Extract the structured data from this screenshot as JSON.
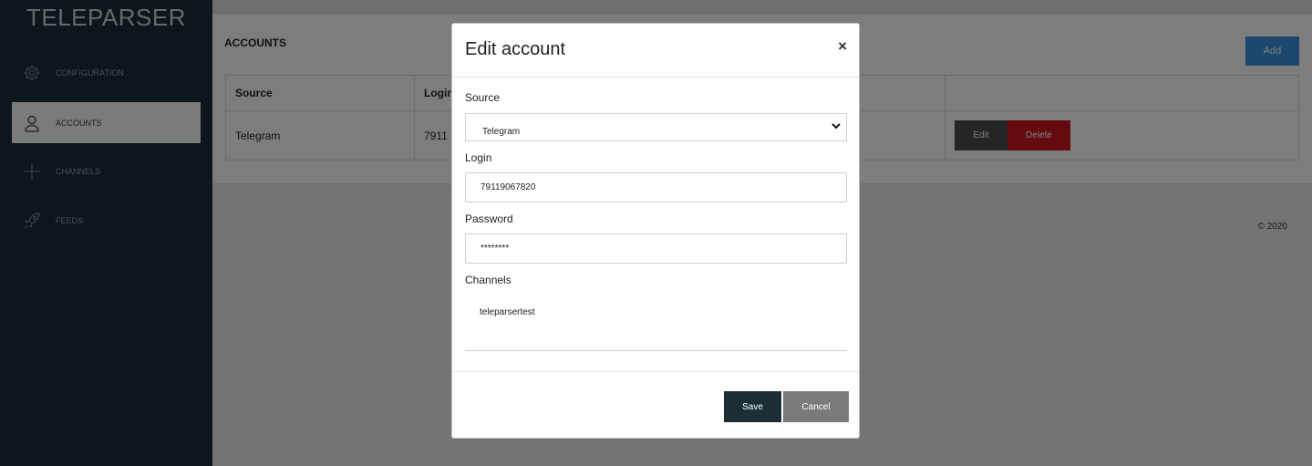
{
  "app": {
    "brand": "TELEPARSER"
  },
  "sidebar": {
    "items": [
      {
        "label": "CONFIGURATION",
        "icon": "gear-icon",
        "active": false
      },
      {
        "label": "ACCOUNTS",
        "icon": "user-icon",
        "active": true
      },
      {
        "label": "CHANNELS",
        "icon": "plus-icon",
        "active": false
      },
      {
        "label": "FEEDS",
        "icon": "rocket-icon",
        "active": false
      }
    ]
  },
  "accounts": {
    "title": "ACCOUNTS",
    "add_label": "Add",
    "columns": [
      "Source",
      "Login",
      "",
      ""
    ],
    "rows": [
      {
        "source": "Telegram",
        "login": "7911",
        "edit_label": "Edit",
        "delete_label": "Delete"
      }
    ]
  },
  "footer": {
    "copyright": "© 2020"
  },
  "modal": {
    "title": "Edit account",
    "close": "×",
    "source_label": "Source",
    "source_value": "Telegram",
    "login_label": "Login",
    "login_value": "79119067820",
    "password_label": "Password",
    "password_value": "********",
    "channels_label": "Channels",
    "channels": [
      "teleparsertest"
    ],
    "save_label": "Save",
    "cancel_label": "Cancel"
  },
  "colors": {
    "sidebar": "#1b2e36",
    "accent": "#3a8fd8",
    "danger": "#c8161e",
    "primary_btn": "#1b2e36"
  }
}
